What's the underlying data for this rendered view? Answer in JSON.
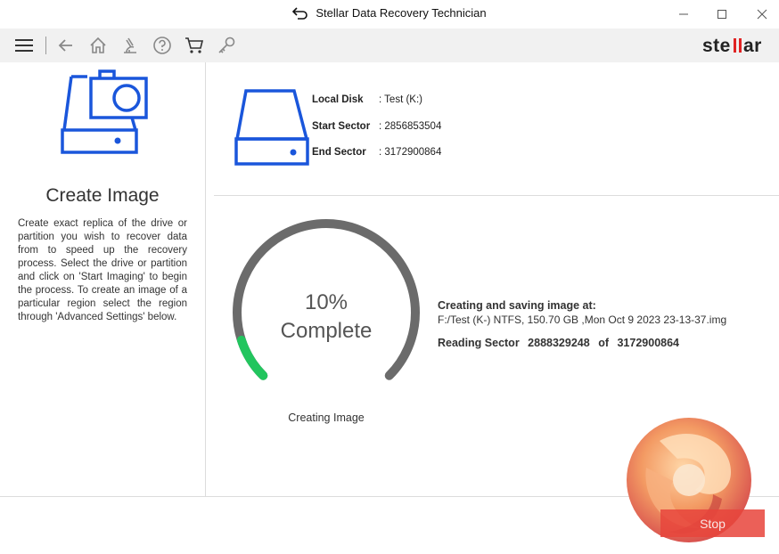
{
  "window": {
    "title": "Stellar Data Recovery Technician"
  },
  "toolbar": {
    "icons": [
      "menu-icon",
      "back-icon",
      "home-icon",
      "microscope-icon",
      "help-icon",
      "cart-icon",
      "key-icon"
    ],
    "brand": "stellar"
  },
  "left": {
    "title": "Create Image",
    "description": "Create exact replica of the drive or partition you wish to recover data from to speed up the recovery process. Select the drive or partition and click on 'Start Imaging' to begin the process. To create an image of a particular region select the region through 'Advanced Settings' below."
  },
  "disk": {
    "local_disk_label": "Local Disk",
    "local_disk_value": ": Test (K:)",
    "start_sector_label": "Start Sector",
    "start_sector_value": ": 2856853504",
    "end_sector_label": "End Sector",
    "end_sector_value": ": 3172900864"
  },
  "progress": {
    "percent": 10,
    "percent_text": "10%",
    "complete_text": "Complete",
    "caption": "Creating Image"
  },
  "status": {
    "heading": "Creating and saving image at:",
    "path": "F:/Test (K-) NTFS, 150.70 GB ,Mon Oct 9 2023 23-13-37.img",
    "reading_label": "Reading Sector",
    "reading_current": "2888329248",
    "reading_of": "of",
    "reading_total": "3172900864"
  },
  "footer": {
    "stop_label": "Stop"
  },
  "colors": {
    "accent_blue": "#1a56db",
    "progress_green": "#22c55e",
    "gauge_gray": "#6b6b6b",
    "stop_red": "#e8453c"
  }
}
